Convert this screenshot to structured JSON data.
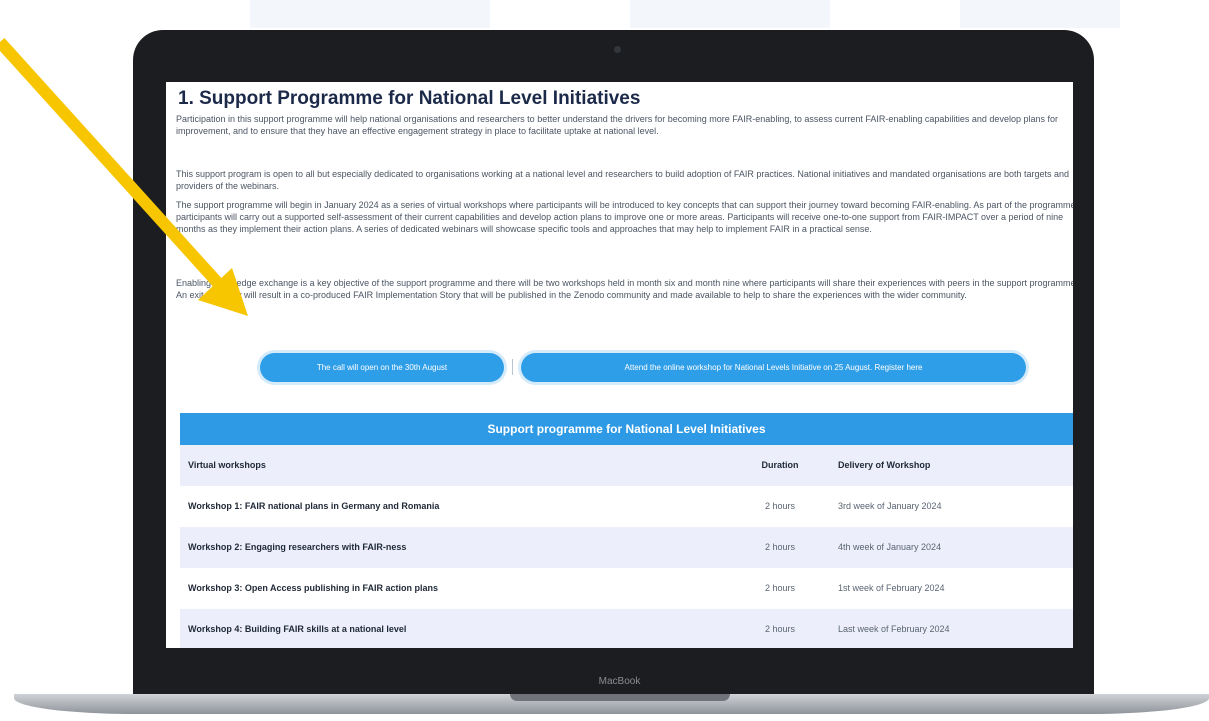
{
  "page": {
    "title": "1. Support Programme for National Level Initiatives",
    "paragraphs": [
      "Participation in this support programme will help national organisations and researchers to better understand the drivers for becoming more FAIR-enabling, to assess current FAIR-enabling capabilities and develop plans for improvement, and to ensure that they have an effective engagement strategy in place to facilitate uptake at national level.",
      "This support program is open to all but especially dedicated to organisations working at a national level and researchers to build adoption of FAIR practices. National initiatives and mandated organisations are both targets and providers of the webinars.",
      "The support programme will begin in January 2024 as a series of virtual workshops where participants will be introduced to key concepts that can support their journey toward becoming FAIR-enabling. As part of the programme, participants will carry out a supported self-assessment of their current capabilities and develop action plans to improve one or more areas. Participants will receive one-to-one support from FAIR-IMPACT over a period of nine months as they implement their action plans. A series of dedicated webinars will showcase specific tools and approaches that may help to implement FAIR in a practical sense.",
      "Enabling knowledge exchange is a key objective of the support programme and there will be two workshops held in month six and month nine where participants will share their experiences with peers in the support programme. An exit interview will result in a co-produced FAIR Implementation Story that will be published in the Zenodo community and made available to help to share the experiences with the wider community."
    ],
    "buttons": {
      "call_open": "The call will open on the 30th August",
      "attend_workshop": "Attend the online workshop for National Levels Initiative on 25 August. Register here"
    }
  },
  "table": {
    "caption": "Support programme for National Level Initiatives",
    "headers": [
      "Virtual workshops",
      "Duration",
      "Delivery of Workshop"
    ],
    "rows": [
      [
        "Workshop 1: FAIR national plans in Germany and Romania",
        "2 hours",
        "3rd week of January 2024"
      ],
      [
        "Workshop 2: Engaging researchers with FAIR-ness",
        "2 hours",
        "4th week of January 2024"
      ],
      [
        "Workshop 3: Open Access publishing in FAIR action plans",
        "2 hours",
        "1st week of February 2024"
      ],
      [
        "Workshop 4: Building FAIR skills at a national level",
        "2 hours",
        "Last week of February 2024"
      ]
    ]
  },
  "device": {
    "label": "MacBook"
  },
  "colors": {
    "accent": "#2e9ae6",
    "arrow": "#f7c600",
    "title": "#1c2a4a",
    "row_alt": "#eceefb"
  }
}
